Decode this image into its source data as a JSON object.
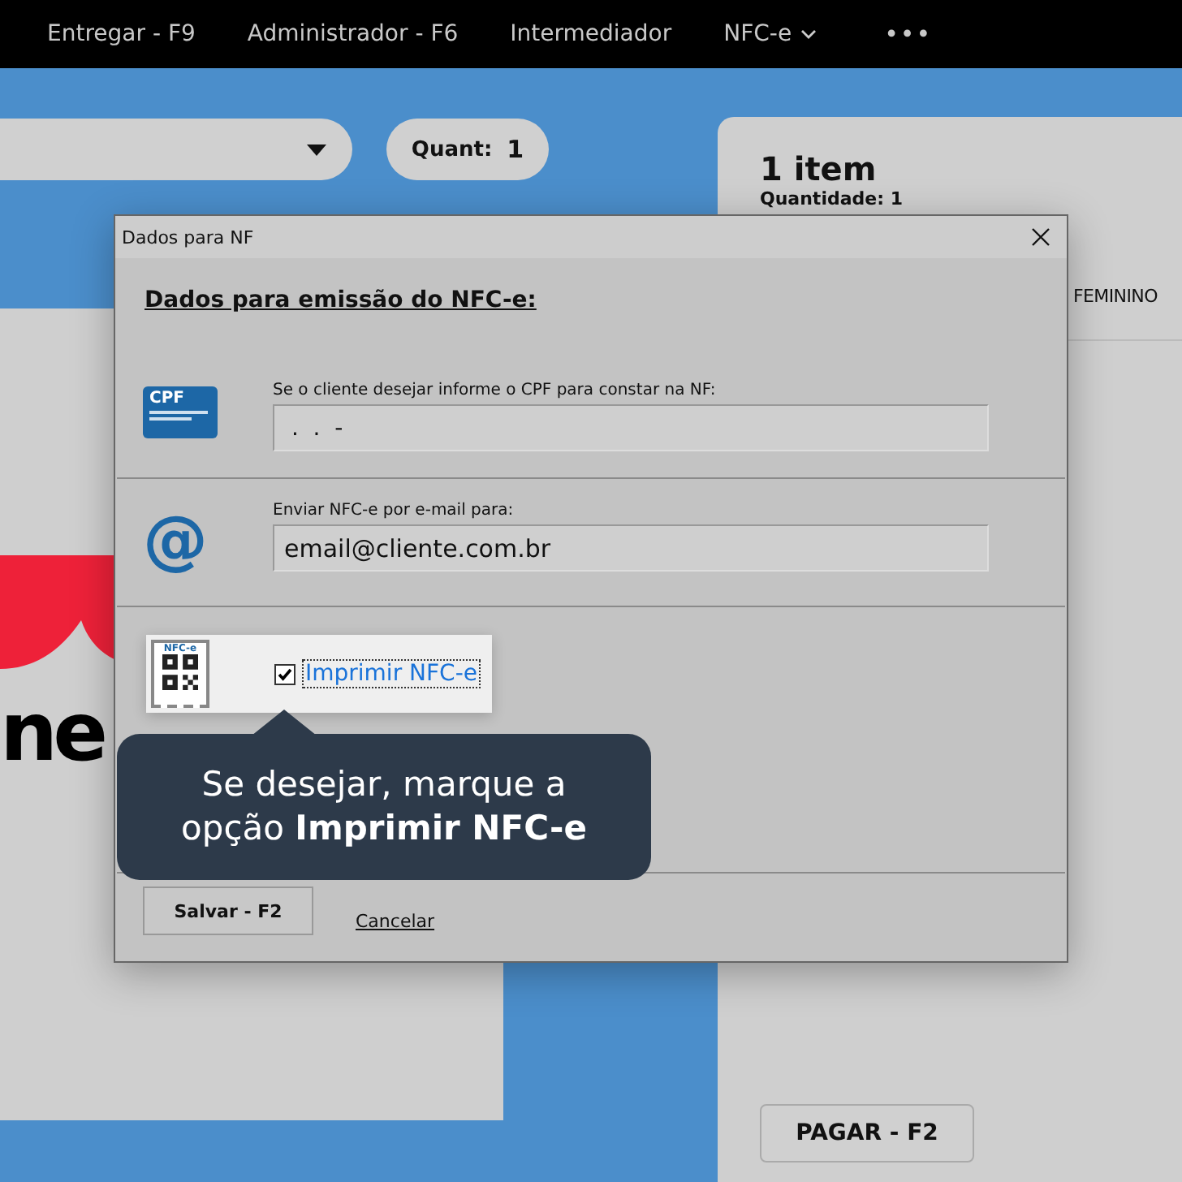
{
  "nav": {
    "items": [
      {
        "label": "Entregar - F9",
        "kind": "link"
      },
      {
        "label": "Administrador - F6",
        "kind": "link"
      },
      {
        "label": "Intermediador",
        "kind": "link"
      },
      {
        "label": "NFC-e",
        "kind": "dropdown"
      },
      {
        "label": "•••",
        "kind": "more"
      }
    ]
  },
  "toolbar": {
    "quantity_label": "Quant:",
    "quantity_value": "1"
  },
  "logo": {
    "text": "ne"
  },
  "cart": {
    "title": "1 item",
    "subtitle": "Quantidade: 1",
    "product": "FEMININO",
    "pay_button": "PAGAR - F2"
  },
  "dialog": {
    "title": "Dados para NF",
    "heading": "Dados para emissão do NFC-e:",
    "cpf": {
      "label": "Se o cliente desejar informe o CPF para constar na NF:",
      "value": " .  .  -",
      "icon_text": "CPF"
    },
    "email": {
      "label": "Enviar NFC-e por e-mail para:",
      "value": "email@cliente.com.br",
      "icon_text": "@"
    },
    "print": {
      "label": "Imprimir NFC-e",
      "checked": true,
      "icon_text": "NFC-e"
    },
    "buttons": [
      {
        "label": "Salvar - F2",
        "kind": "button"
      },
      {
        "label": "Cancelar",
        "kind": "link"
      }
    ]
  },
  "tooltip": {
    "text": "Se desejar, marque a opção **Imprimir NFC-e**"
  }
}
